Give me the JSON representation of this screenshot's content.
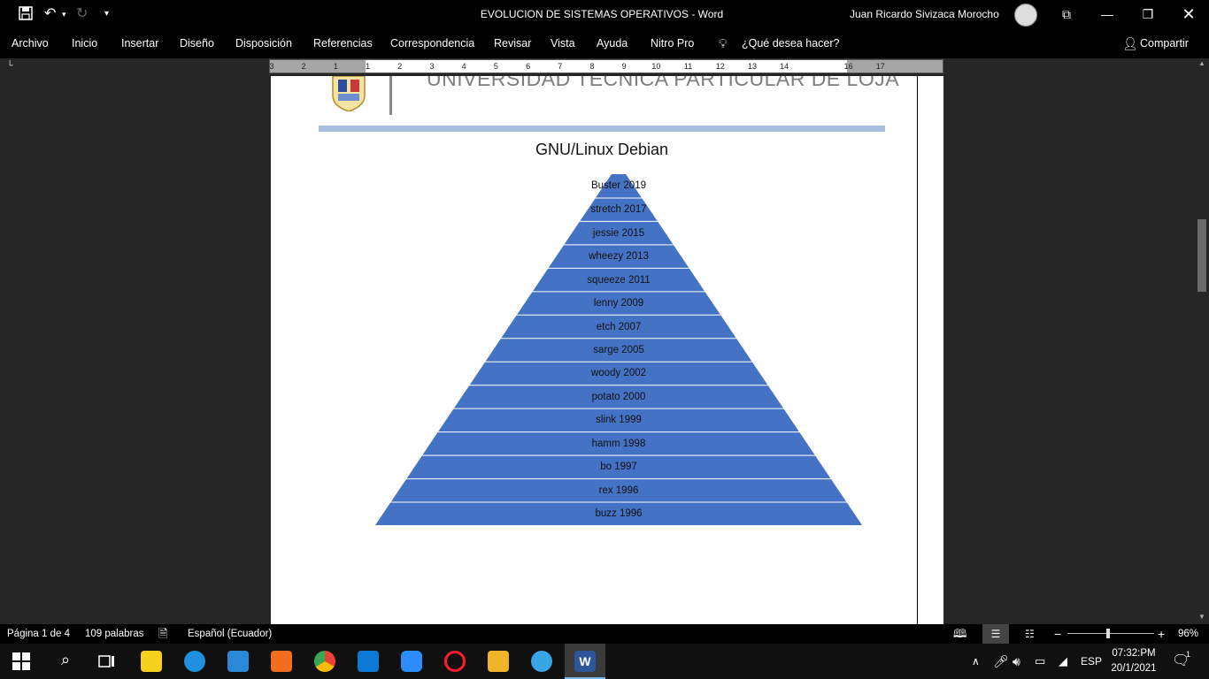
{
  "titlebar": {
    "document_title": "EVOLUCION DE SISTEMAS OPERATIVOS  -  Word",
    "user_name": "Juan Ricardo Sivizaca Morocho"
  },
  "menu": {
    "items": [
      "Archivo",
      "Inicio",
      "Insertar",
      "Diseño",
      "Disposición",
      "Referencias",
      "Correspondencia",
      "Revisar",
      "Vista",
      "Ayuda",
      "Nitro Pro"
    ],
    "tell_me": "¿Qué desea hacer?",
    "share": "Compartir"
  },
  "ruler": {
    "numbers": [
      "3",
      "2",
      "1",
      "1",
      "2",
      "3",
      "4",
      "5",
      "6",
      "7",
      "8",
      "9",
      "10",
      "11",
      "12",
      "13",
      "14",
      "16",
      "17"
    ]
  },
  "document": {
    "header_text": "UNIVERSIDAD TÉCNICA PARTICULAR DE LOJA",
    "pyramid_title": "GNU/Linux Debian",
    "pyramid_color": "#4472c4",
    "pyramid_levels": [
      "Buster 2019",
      "stretch 2017",
      "jessie 2015",
      "wheezy 2013",
      "squeeze 2011",
      "lenny 2009",
      "etch 2007",
      "sarge 2005",
      "woody 2002",
      "potato 2000",
      "slink 1999",
      "hamm 1998",
      "bo 1997",
      "rex 1996",
      "buzz 1996"
    ]
  },
  "status": {
    "page": "Página 1 de 4",
    "words": "109 palabras",
    "language": "Español (Ecuador)",
    "zoom": "96%"
  },
  "taskbar": {
    "lang": "ESP",
    "time": "07:32:PM",
    "date": "20/1/2021",
    "notifications": "1"
  }
}
